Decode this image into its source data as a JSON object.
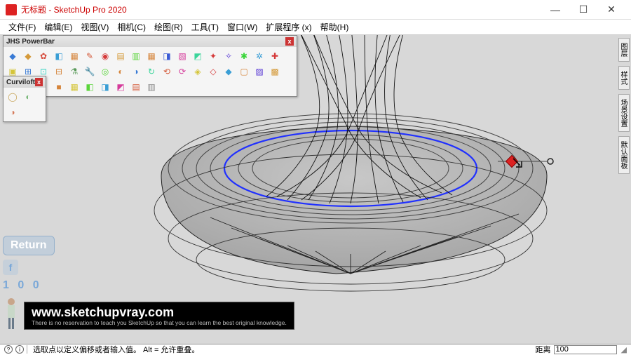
{
  "titlebar": {
    "title": "无标题 - SketchUp Pro 2020",
    "minimize": "—",
    "maximize": "☐",
    "close": "✕"
  },
  "menubar": {
    "items": [
      "文件(F)",
      "编辑(E)",
      "视图(V)",
      "相机(C)",
      "绘图(R)",
      "工具(T)",
      "窗口(W)",
      "扩展程序 (x)",
      "帮助(H)"
    ]
  },
  "toolbars": {
    "powerbar": {
      "title": "JHS PowerBar",
      "close": "x",
      "icons": [
        {
          "glyph": "◆",
          "color": "#3a7bd5"
        },
        {
          "glyph": "◆",
          "color": "#d59a3a"
        },
        {
          "glyph": "✿",
          "color": "#d5483a"
        },
        {
          "glyph": "◧",
          "color": "#3a9ed5"
        },
        {
          "glyph": "▦",
          "color": "#d5843a"
        },
        {
          "glyph": "✎",
          "color": "#d55a3a"
        },
        {
          "glyph": "◉",
          "color": "#d53a3a"
        },
        {
          "glyph": "▤",
          "color": "#d59a3a"
        },
        {
          "glyph": "▥",
          "color": "#5ad53a"
        },
        {
          "glyph": "▦",
          "color": "#d5843a"
        },
        {
          "glyph": "◨",
          "color": "#3a5ad5"
        },
        {
          "glyph": "▧",
          "color": "#d53a9a"
        },
        {
          "glyph": "◩",
          "color": "#3ad59a"
        },
        {
          "glyph": "✦",
          "color": "#d53a3a"
        },
        {
          "glyph": "✧",
          "color": "#5a3ad5"
        },
        {
          "glyph": "✱",
          "color": "#3ad53a"
        },
        {
          "glyph": "✲",
          "color": "#3a9ed5"
        },
        {
          "glyph": "✚",
          "color": "#d53a3a"
        },
        {
          "glyph": "▣",
          "color": "#d5c53a"
        },
        {
          "glyph": "⊞",
          "color": "#3a7bd5"
        },
        {
          "glyph": "⊡",
          "color": "#3ad5c5"
        },
        {
          "glyph": "⊟",
          "color": "#d5843a"
        },
        {
          "glyph": "⚗",
          "color": "#5a9a5a"
        },
        {
          "glyph": "🔧",
          "color": "#888"
        },
        {
          "glyph": "◎",
          "color": "#5ad53a"
        },
        {
          "glyph": "◐",
          "color": "#d5843a"
        },
        {
          "glyph": "◑",
          "color": "#3a7bd5"
        },
        {
          "glyph": "↻",
          "color": "#3ad59a"
        },
        {
          "glyph": "⟲",
          "color": "#d55a3a"
        },
        {
          "glyph": "⟳",
          "color": "#d53a9a"
        },
        {
          "glyph": "◈",
          "color": "#d5c53a"
        },
        {
          "glyph": "◇",
          "color": "#d53a3a"
        },
        {
          "glyph": "◆",
          "color": "#3a9ed5"
        },
        {
          "glyph": "▢",
          "color": "#d5843a"
        },
        {
          "glyph": "▨",
          "color": "#5a3ad5"
        },
        {
          "glyph": "▩",
          "color": "#d59a3a"
        },
        {
          "glyph": "◫",
          "color": "#3ad53a"
        },
        {
          "glyph": "◪",
          "color": "#d53a3a"
        },
        {
          "glyph": "■",
          "color": "#3a7bd5"
        },
        {
          "glyph": "■",
          "color": "#d5843a"
        },
        {
          "glyph": "▦",
          "color": "#d5c53a"
        },
        {
          "glyph": "◧",
          "color": "#5ad53a"
        },
        {
          "glyph": "◨",
          "color": "#3a9ed5"
        },
        {
          "glyph": "◩",
          "color": "#d53a9a"
        },
        {
          "glyph": "▤",
          "color": "#d55a3a"
        },
        {
          "glyph": "▥",
          "color": "#888"
        }
      ]
    },
    "curviloft": {
      "title": "Curviloft",
      "close": "x",
      "icons": [
        {
          "glyph": "◯",
          "color": "#c8a55a"
        },
        {
          "glyph": "◐",
          "color": "#7ab87a"
        },
        {
          "glyph": "◑",
          "color": "#d57a5a"
        }
      ]
    }
  },
  "right_tabs": [
    "图层",
    "样式",
    "场景设置",
    "默认面板"
  ],
  "watermark": {
    "return_label": "Return",
    "f_label": "f",
    "counter": "1 0 0",
    "url": "www.sketchupvray.com",
    "subtitle": "There is no reservation to teach you SketchUp so that you can learn the best original knowledge."
  },
  "statusbar": {
    "hint": "选取点以定义偏移或者输入值。  Alt = 允许重叠。",
    "field_label": "距离",
    "field_value": "100"
  }
}
